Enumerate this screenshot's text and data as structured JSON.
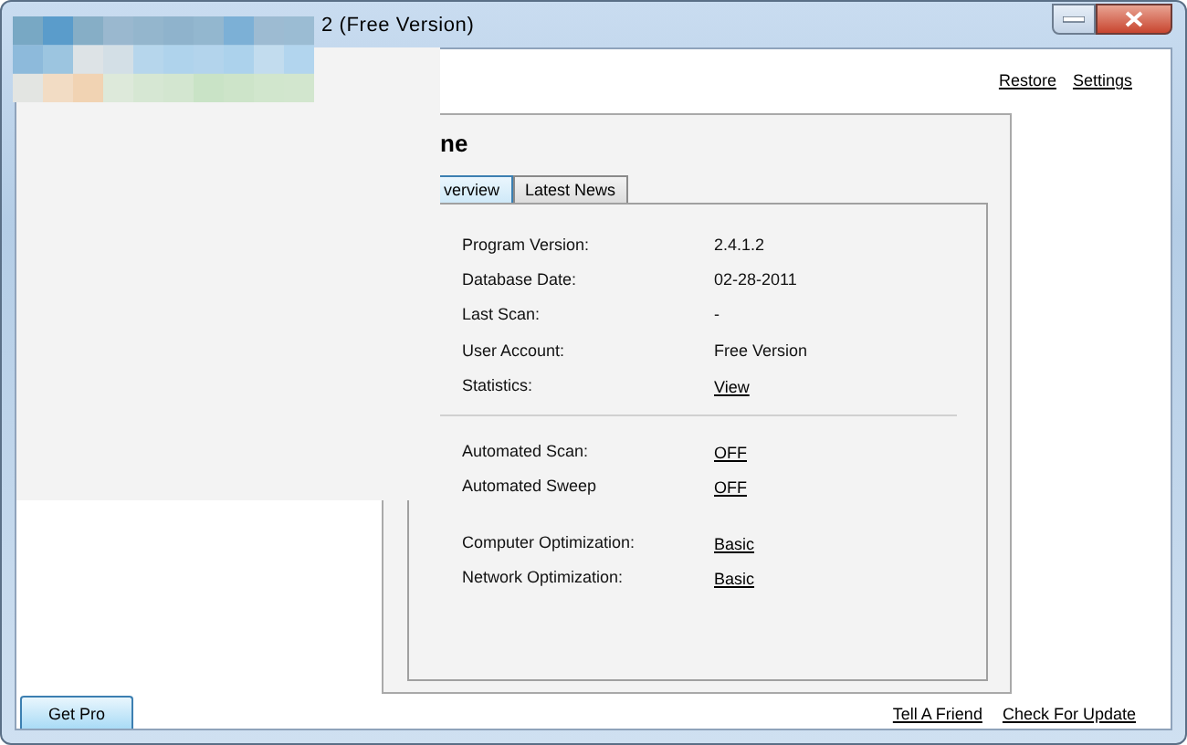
{
  "window": {
    "title": "2  (Free Version)"
  },
  "top_links": [
    "Restore",
    "Settings"
  ],
  "heading": "ne",
  "tabs": [
    {
      "label": "verview",
      "selected": true
    },
    {
      "label": "Latest News",
      "selected": false
    }
  ],
  "info_groups": [
    {
      "rows": [
        {
          "label": "Program Version:",
          "value": "2.4.1.2",
          "kind": "text"
        },
        {
          "label": "Database Date:",
          "value": "02-28-2011",
          "kind": "text"
        },
        {
          "label": "Last Scan:",
          "value": "-",
          "kind": "text"
        },
        {
          "label": "User Account:",
          "value": "Free Version",
          "kind": "text"
        },
        {
          "label": "Statistics:",
          "value": "View",
          "kind": "link"
        }
      ]
    },
    {
      "rows": [
        {
          "label": "Automated Scan:",
          "value": "OFF",
          "kind": "link"
        },
        {
          "label": "Automated Sweep",
          "value": "OFF",
          "kind": "link"
        }
      ]
    },
    {
      "rows": [
        {
          "label": "Computer Optimization:",
          "value": "Basic",
          "kind": "link"
        },
        {
          "label": "Network Optimization:",
          "value": "Basic",
          "kind": "link"
        }
      ]
    }
  ],
  "footer": {
    "button": "Get Pro",
    "links": [
      "Tell A Friend",
      "Check For Update"
    ]
  }
}
